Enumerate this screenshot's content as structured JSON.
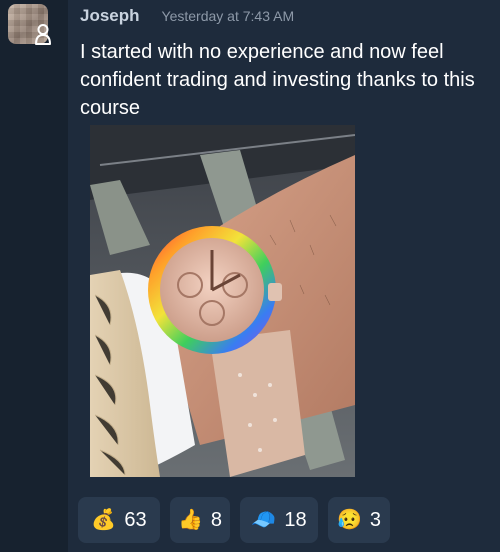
{
  "message": {
    "author": "Joseph",
    "timestamp": "Yesterday at 7:43 AM",
    "text": "I started with no experience and now feel confident trading and investing thanks to this course"
  },
  "avatar": {
    "badge_icon": "person-outline-icon"
  },
  "attachment": {
    "kind": "photo",
    "subject": "watch-photo"
  },
  "reactions": [
    {
      "emoji": "💰",
      "icon": "money-bag-icon",
      "count": "63"
    },
    {
      "emoji": "👍",
      "icon": "thumbs-up-icon",
      "count": "8"
    },
    {
      "emoji": "🧢",
      "icon": "cap-icon",
      "count": "18"
    },
    {
      "emoji": "😥",
      "icon": "sad-face-icon",
      "count": "3"
    }
  ],
  "colors": {
    "background": "#1e2b3c",
    "gutter": "#17222f",
    "reaction_bg": "#2a3a4e",
    "author": "#c9d3df",
    "timestamp": "#8d99a8"
  }
}
